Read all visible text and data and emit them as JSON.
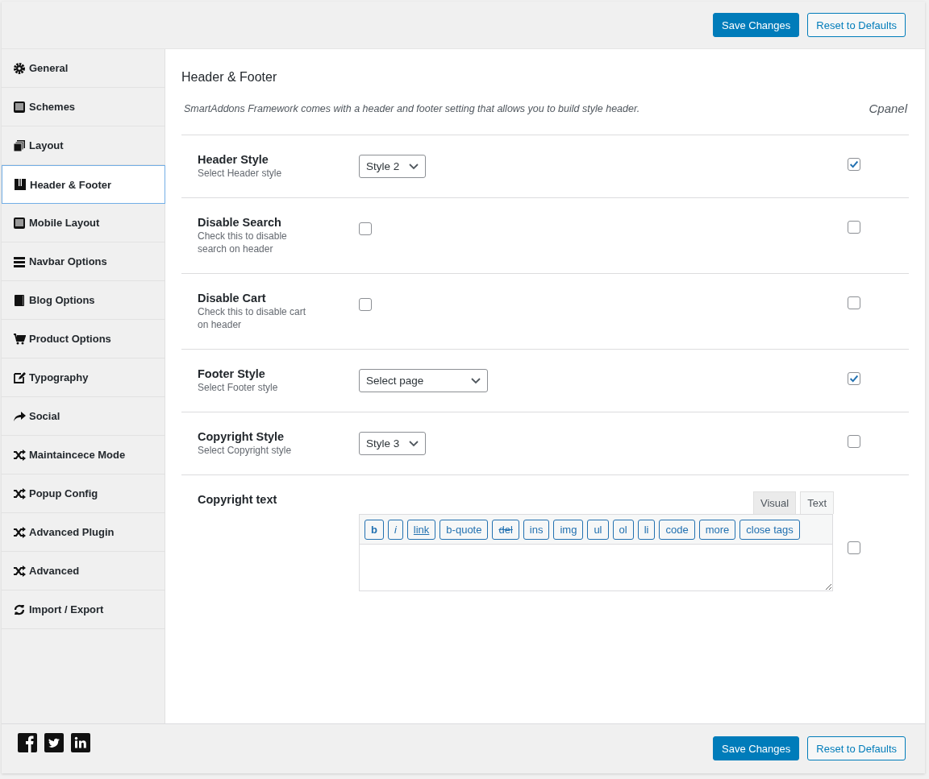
{
  "top_bar": {
    "buttons": [
      {
        "label": "Save Changes",
        "kind": "primary"
      },
      {
        "label": "Reset to Defaults",
        "kind": "secondary"
      }
    ]
  },
  "sidebar": {
    "items": [
      {
        "label": "General",
        "selected": false
      },
      {
        "label": "Schemes",
        "selected": false
      },
      {
        "label": "Layout",
        "selected": false
      },
      {
        "label": "Header & Footer",
        "selected": true
      },
      {
        "label": "Mobile Layout",
        "selected": false
      },
      {
        "label": "Navbar Options",
        "selected": false
      },
      {
        "label": "Blog Options",
        "selected": false
      },
      {
        "label": "Product Options",
        "selected": false
      },
      {
        "label": "Typography",
        "selected": false
      },
      {
        "label": "Social",
        "selected": false
      },
      {
        "label": "Maintaincece Mode",
        "selected": false
      },
      {
        "label": "Popup Config",
        "selected": false
      },
      {
        "label": "Advanced Plugin",
        "selected": false
      },
      {
        "label": "Advanced",
        "selected": false
      },
      {
        "label": "Import / Export",
        "selected": false
      }
    ]
  },
  "section": {
    "title": "Header & Footer",
    "description": "SmartAddons Framework comes with a header and footer setting that allows you to build style header.",
    "cpanel_label": "Cpanel",
    "options": [
      {
        "title": "Header Style",
        "description": "Select Header style",
        "kind": "select",
        "value": "Style 2",
        "checked": true
      },
      {
        "title": "Disable Search",
        "description": "Check this to disable search on header",
        "kind": "checkbox",
        "value_checked": false,
        "checked": false
      },
      {
        "title": "Disable Cart",
        "description": "Check this to disable cart on header",
        "kind": "checkbox",
        "value_checked": false,
        "checked": false
      },
      {
        "title": "Footer Style",
        "description": "Select Footer style",
        "kind": "select",
        "value": "Select page",
        "checked": true
      },
      {
        "title": "Copyright Style",
        "description": "Select Copyright style",
        "kind": "select",
        "value": "Style 3",
        "checked": false
      },
      {
        "title": "Copyright text",
        "kind": "editor",
        "checked": false,
        "tabs": [
          {
            "label": "Visual",
            "selected": false
          },
          {
            "label": "Text",
            "selected": true
          }
        ],
        "quicktags": [
          {
            "label": "b",
            "kind": "bold"
          },
          {
            "label": "i",
            "kind": "italic"
          },
          {
            "label": "link",
            "kind": "underline"
          },
          {
            "label": "b-quote",
            "kind": "plain"
          },
          {
            "label": "del",
            "kind": "strike"
          },
          {
            "label": "ins",
            "kind": "plain"
          },
          {
            "label": "img",
            "kind": "plain"
          },
          {
            "label": "ul",
            "kind": "plain"
          },
          {
            "label": "ol",
            "kind": "plain"
          },
          {
            "label": "li",
            "kind": "plain"
          },
          {
            "label": "code",
            "kind": "plain"
          },
          {
            "label": "more",
            "kind": "plain"
          },
          {
            "label": "close tags",
            "kind": "plain"
          }
        ]
      }
    ]
  },
  "footer": {
    "buttons": [
      {
        "label": "Save Changes",
        "kind": "primary"
      },
      {
        "label": "Reset to Defaults",
        "kind": "secondary"
      }
    ]
  }
}
